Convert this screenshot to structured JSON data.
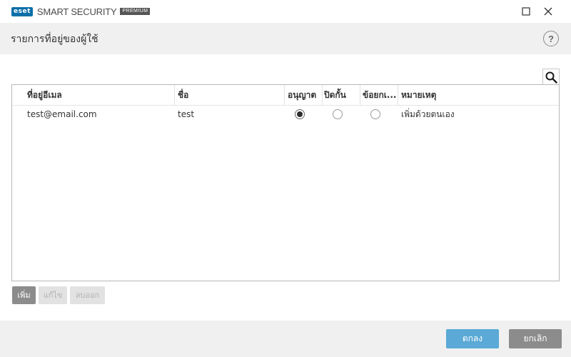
{
  "window": {
    "brand": "eset",
    "product_name": "SMART SECURITY",
    "edition": "PREMIUM"
  },
  "header": {
    "title": "รายการที่อยู่ของผู้ใช้",
    "help_label": "?"
  },
  "table": {
    "columns": [
      "ที่อยู่อีเมล",
      "ชื่อ",
      "อนุญาต",
      "ปิดกั้น",
      "ข้อยกเ..."
    ],
    "notes_column": "หมายเหตุ",
    "rows": [
      {
        "email": "test@email.com",
        "name": "test",
        "allow": true,
        "block": false,
        "exception": false,
        "note": "เพิ่มด้วยตนเอง"
      }
    ]
  },
  "actions": {
    "add_label": "เพิ่ม",
    "edit_label": "แก้ไข",
    "remove_label": "ลบออก"
  },
  "footer": {
    "ok_label": "ตกลง",
    "cancel_label": "ยกเลิก"
  },
  "colors": {
    "brand": "#0b6fa8",
    "ok_button": "#5aa9d6",
    "neutral_button": "#8c8c8c"
  }
}
